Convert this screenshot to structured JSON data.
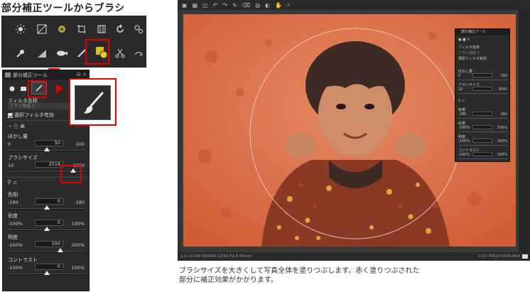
{
  "heading": "部分補正ツールからブラシ",
  "palette": {
    "title": "部分補正ツール",
    "filter_label": "フィルタ名称",
    "filter_value": "ブラシ領域 1",
    "checkbox_label": "選択フィルタ有効",
    "sliders": [
      {
        "label": "ぼかし量",
        "min": "0",
        "value": "50",
        "max": "100",
        "fraction": 0.5
      },
      {
        "label": "ブラシサイズ",
        "min": "10",
        "value": "2518",
        "max": "3000",
        "fraction": 0.84
      },
      {
        "label": "色相",
        "min": "-180",
        "value": "0",
        "max": "180",
        "fraction": 0.5
      },
      {
        "label": "彩度",
        "min": "-100%",
        "value": "0",
        "max": "100%",
        "fraction": 0.5
      },
      {
        "label": "明度",
        "min": "-100%",
        "value": "100",
        "max": "200%",
        "fraction": 0.67
      },
      {
        "label": "コントラスト",
        "min": "-100%",
        "value": "0",
        "max": "100%",
        "fraction": 0.5
      }
    ]
  },
  "editor": {
    "status_left": "1:4  11149  ISO400  1/250  F2.8  85mm",
    "status_right": "CCD  7952×5304  8bit"
  },
  "caption": {
    "line1": "ブラシサイズを大きくして写真全体を塗りつぶします。赤く塗りつぶされた",
    "line2": "部分に補正効果がかかります。"
  },
  "colors": {
    "highlight": "#e00000",
    "panel_bg": "#2b2b2b",
    "mask_overlay": "#e07048"
  }
}
